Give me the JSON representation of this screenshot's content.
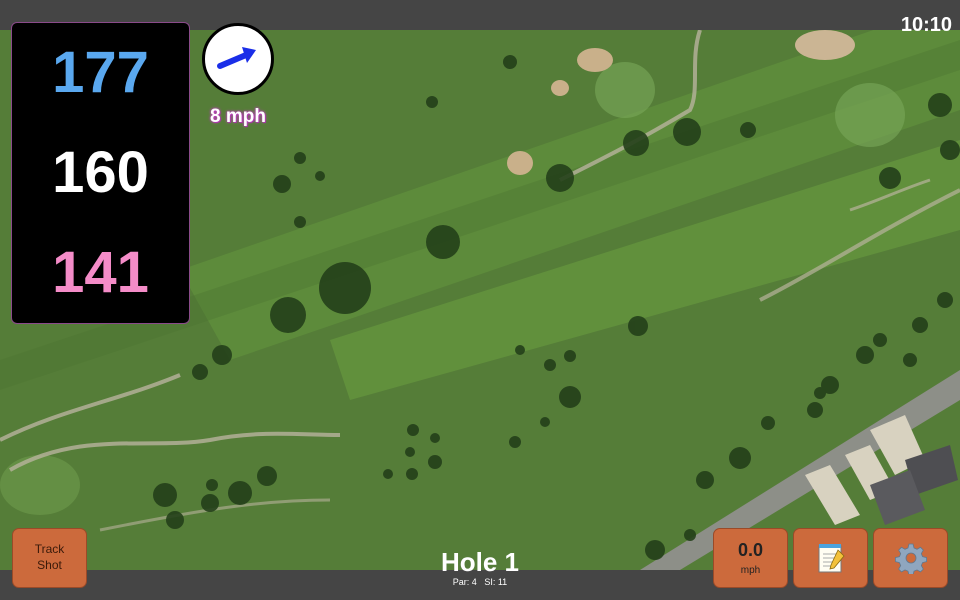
{
  "status": {
    "time": "10:10"
  },
  "distances": {
    "back": "177",
    "middle": "160",
    "front": "141",
    "colors": {
      "back": "#5aa8ef",
      "middle": "#ffffff",
      "front": "#f48cc8"
    }
  },
  "wind": {
    "speed": "8 mph",
    "icon": "wind-arrow-icon",
    "arrow_color": "#1a2ee8"
  },
  "hole": {
    "title": "Hole 1",
    "par": "Par: 4",
    "si": "SI: 11"
  },
  "buttons": {
    "track_shot_line1": "Track",
    "track_shot_line2": "Shot",
    "speed_value": "0.0",
    "speed_unit": "mph",
    "notes_icon": "notepad-icon",
    "settings_icon": "gear-icon"
  }
}
